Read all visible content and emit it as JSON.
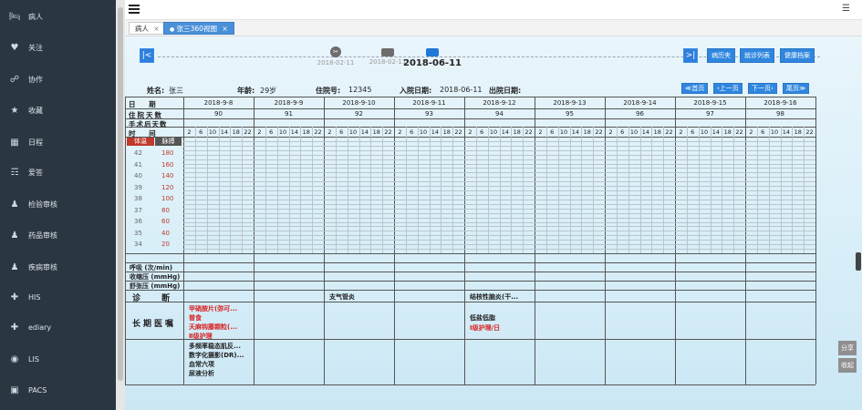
{
  "sidebar": {
    "items": [
      {
        "label": "病人",
        "icon": "bed-icon",
        "glyph": "🛏"
      },
      {
        "label": "关注",
        "icon": "heart-icon",
        "glyph": "♥"
      },
      {
        "label": "协作",
        "icon": "collaboration-icon",
        "glyph": "☍"
      },
      {
        "label": "收藏",
        "icon": "star-icon",
        "glyph": "★"
      },
      {
        "label": "日程",
        "icon": "calendar-icon",
        "glyph": "▦"
      },
      {
        "label": "爱答",
        "icon": "qa-icon",
        "glyph": "☶"
      },
      {
        "label": "检验审核",
        "icon": "user-icon",
        "glyph": "♟"
      },
      {
        "label": "药品审核",
        "icon": "user-icon",
        "glyph": "♟"
      },
      {
        "label": "疾病审核",
        "icon": "user-icon",
        "glyph": "♟"
      },
      {
        "label": "HIS",
        "icon": "his-icon",
        "glyph": "✚"
      },
      {
        "label": "ediary",
        "icon": "ediary-icon",
        "glyph": "✚"
      },
      {
        "label": "LIS",
        "icon": "lis-icon",
        "glyph": "◉"
      },
      {
        "label": "PACS",
        "icon": "pacs-icon",
        "glyph": "▣"
      }
    ]
  },
  "tabs": [
    {
      "label": "病人",
      "close": "×"
    },
    {
      "label": "张三360视图",
      "close": "×",
      "dot": "●"
    }
  ],
  "timeline": {
    "prev": "|<",
    "next": ">|",
    "nodes": [
      {
        "date": "2018-02-11",
        "kind": "surgery"
      },
      {
        "date": "2018-02-11",
        "kind": "bed"
      },
      {
        "date": "2018-06-11",
        "kind": "bed-current"
      }
    ],
    "surgery_glyph": "✂",
    "buttons": [
      "病历夹",
      "就诊列表",
      "健康档案"
    ]
  },
  "patient": {
    "name_k": "姓名:",
    "name_v": "张三",
    "age_k": "年龄:",
    "age_v": "29岁",
    "hosp_k": "住院号:",
    "hosp_v": "12345",
    "in_k": "入院日期:",
    "in_v": "2018-06-11",
    "out_k": "出院日期:",
    "out_v": ""
  },
  "pager": [
    "≪首页",
    "‹上一页",
    "下一页›",
    "尾页≫"
  ],
  "chart": {
    "date_label": "日 期",
    "days_label": "住院天数",
    "postop_label": "手术后天数",
    "time_label": "时 间",
    "dates": [
      "2018-9-8",
      "2018-9-9",
      "2018-9-10",
      "2018-9-11",
      "2018-9-12",
      "2018-9-13",
      "2018-9-14",
      "2018-9-15",
      "2018-9-16"
    ],
    "hospital_days": [
      "90",
      "91",
      "92",
      "93",
      "94",
      "95",
      "96",
      "97",
      "98"
    ],
    "hours": [
      "2",
      "6",
      "10",
      "14",
      "18",
      "22"
    ],
    "temp_header": "体温",
    "pulse_header": "脉搏",
    "temp_scale": [
      "42",
      "41",
      "40",
      "39",
      "38",
      "37",
      "36",
      "35",
      "34"
    ],
    "pulse_scale": [
      "180",
      "160",
      "140",
      "120",
      "100",
      "80",
      "60",
      "40",
      "20"
    ],
    "resp_label": "呼吸 (次/min)",
    "sys_label": "收缩压 (mmHg)",
    "dia_label": "舒张压 (mmHg)",
    "diag_label": "诊 断",
    "diagnoses": [
      {
        "col": 2,
        "text": "支气管炎"
      },
      {
        "col": 4,
        "text": "结核性脑炎(干..."
      }
    ],
    "orders_label": "长期医嘱",
    "orders_col0": [
      {
        "text": "甲硝胺片(弥可...",
        "red": true
      },
      {
        "text": "普食",
        "red": true
      },
      {
        "text": "天麻钩藤颗粒(...",
        "red": true
      },
      {
        "text": "Ⅱ级护理",
        "red": true
      }
    ],
    "orders_col4": [
      {
        "text": "低盐低脂",
        "red": false
      },
      {
        "text": "Ⅰ级护理/日",
        "red": true
      }
    ],
    "exams_col0": [
      "多频率稳态肌反...",
      "数字化摄影(DR)...",
      "血常六项",
      "尿液分析"
    ]
  },
  "float": {
    "share": "分享",
    "fold": "收起"
  },
  "colors": {
    "sidebar": "#2b3643",
    "accent": "#2f86de",
    "red": "#d82020"
  }
}
